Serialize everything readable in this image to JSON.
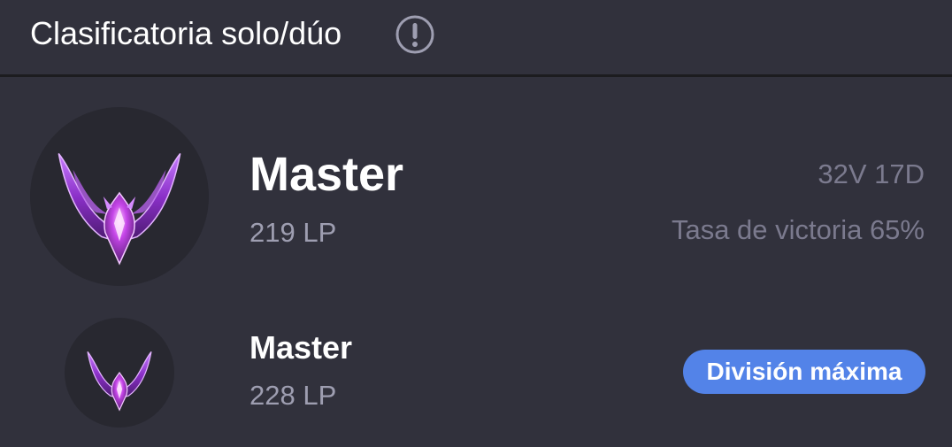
{
  "header": {
    "title": "Clasificatoria solo/dúo",
    "info_icon": "exclamation-circle-icon"
  },
  "current_rank": {
    "emblem_icon": "master-tier-emblem-icon",
    "tier": "Master",
    "lp": "219 LP",
    "record": "32V 17D",
    "win_rate": "Tasa de victoria 65%"
  },
  "peak_rank": {
    "emblem_icon": "master-tier-emblem-icon",
    "tier": "Master",
    "lp": "228 LP",
    "badge_label": "División máxima"
  },
  "colors": {
    "background": "#31313c",
    "emblem_bg": "#282830",
    "muted_text": "#9e9eb1",
    "stats_text": "#7b7a8e",
    "badge": "#5383e8",
    "emblem_purple": "#a23fd8"
  }
}
